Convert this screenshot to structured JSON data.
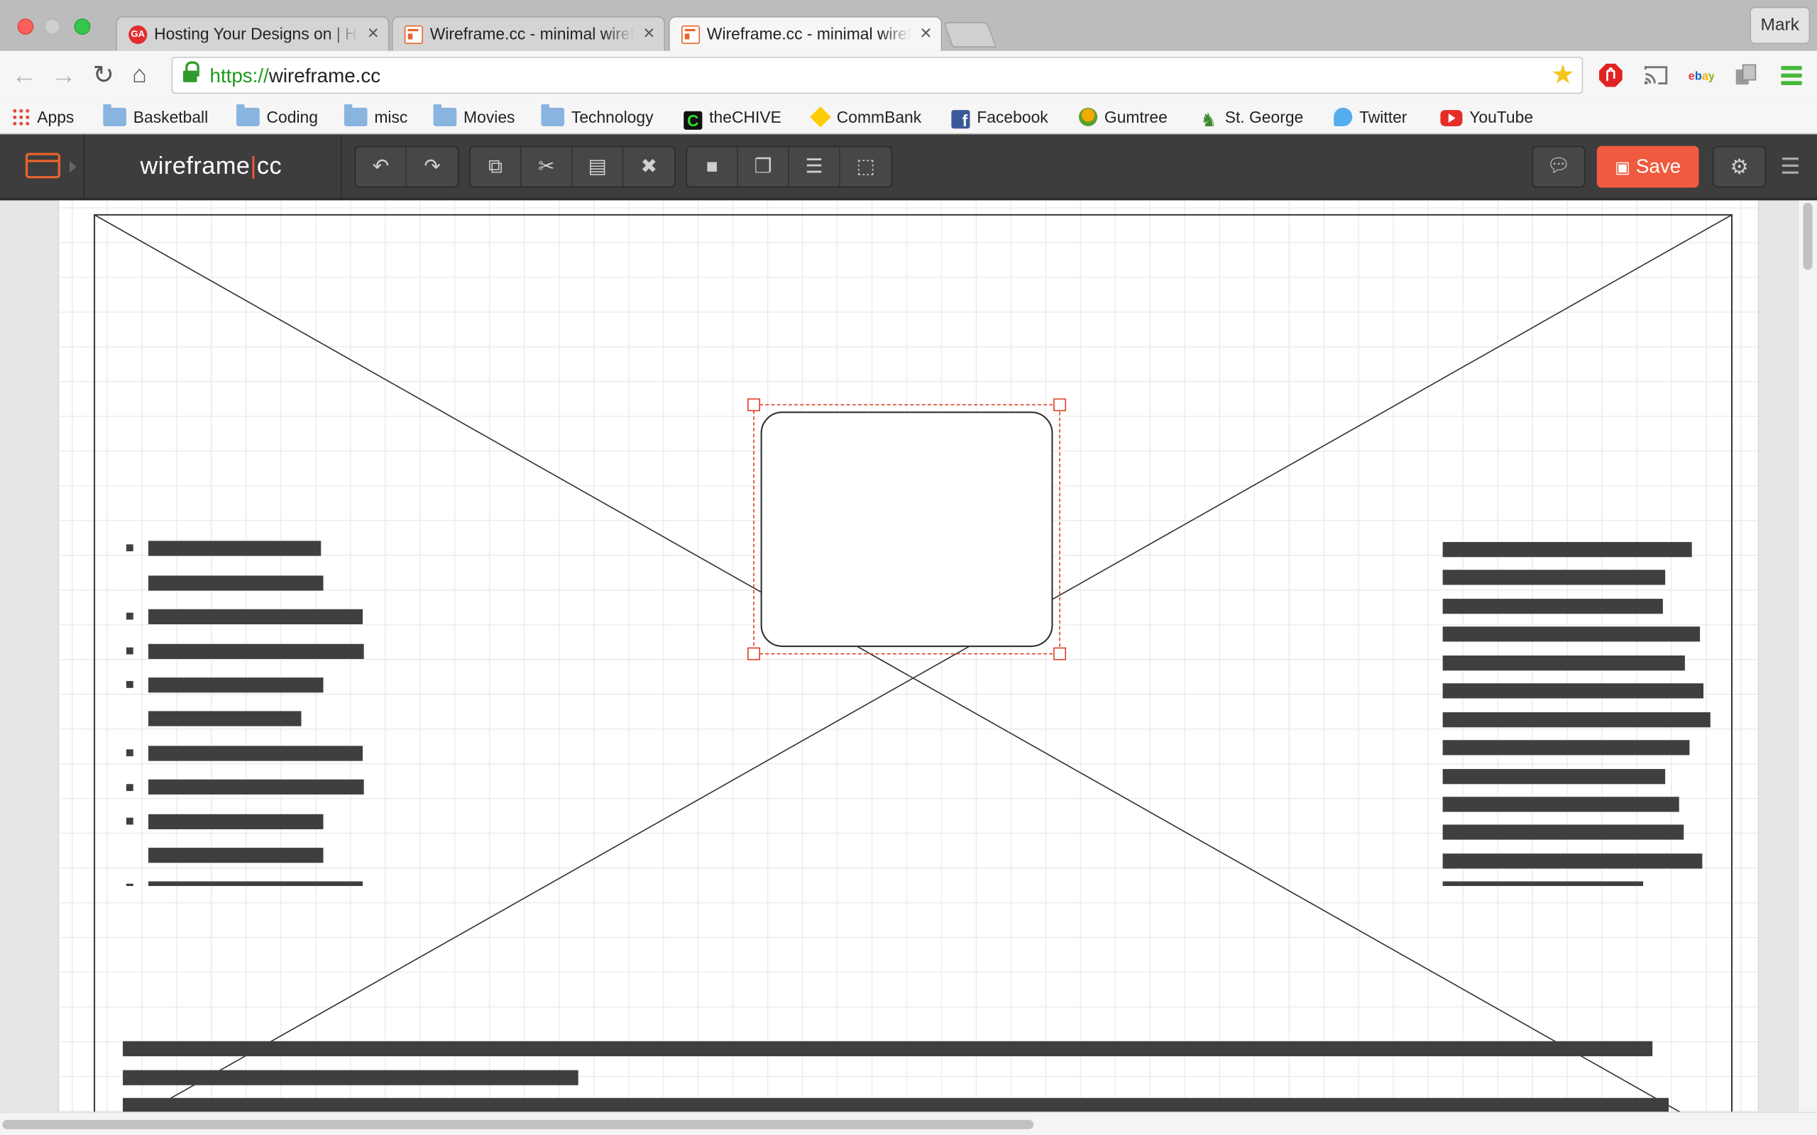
{
  "window": {
    "profile_name": "Mark"
  },
  "tabs": [
    {
      "title": "Hosting Your Designs on | Hosting",
      "icon": "ga-icon",
      "active": false
    },
    {
      "title": "Wireframe.cc - minimal wireframing tool",
      "icon": "wireframe-icon",
      "active": false
    },
    {
      "title": "Wireframe.cc - minimal wireframing tool",
      "icon": "wireframe-icon",
      "active": true
    }
  ],
  "address_bar": {
    "scheme": "https://",
    "host": "wireframe.cc"
  },
  "bookmarks": [
    {
      "label": "Apps",
      "icon": "apps-grid-icon"
    },
    {
      "label": "Basketball",
      "icon": "folder-icon"
    },
    {
      "label": "Coding",
      "icon": "folder-icon"
    },
    {
      "label": "misc",
      "icon": "folder-icon"
    },
    {
      "label": "Movies",
      "icon": "folder-icon"
    },
    {
      "label": "Technology",
      "icon": "folder-icon"
    },
    {
      "label": "theCHIVE",
      "icon": "thechive-icon"
    },
    {
      "label": "CommBank",
      "icon": "commbank-icon"
    },
    {
      "label": "Facebook",
      "icon": "facebook-icon"
    },
    {
      "label": "Gumtree",
      "icon": "gumtree-icon"
    },
    {
      "label": "St. George",
      "icon": "st-george-icon"
    },
    {
      "label": "Twitter",
      "icon": "twitter-icon"
    },
    {
      "label": "YouTube",
      "icon": "youtube-icon"
    }
  ],
  "app": {
    "brand_left": "wireframe",
    "brand_sep": "|",
    "brand_right": "cc",
    "save_label": "Save",
    "accent_color": "#f05a3e"
  },
  "toolbar_groups": [
    [
      "undo-icon",
      "redo-icon"
    ],
    [
      "copy-icon",
      "cut-icon",
      "paste-icon",
      "delete-icon"
    ],
    [
      "lock-icon",
      "arrange-icon",
      "align-icon",
      "group-icon"
    ]
  ],
  "canvas": {
    "selection_color": "#e0402a",
    "left_list_bullets": 7,
    "right_text_lines": 12
  }
}
